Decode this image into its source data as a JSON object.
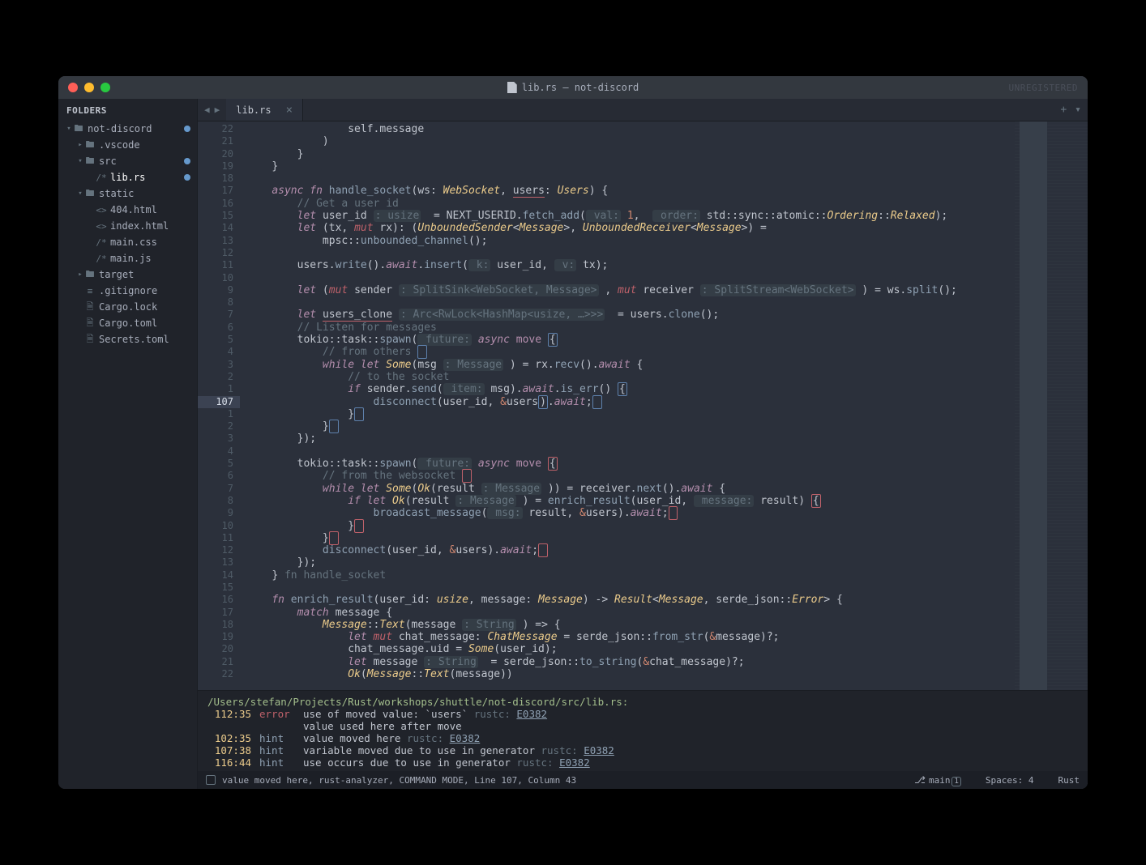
{
  "window": {
    "title": "lib.rs — not-discord",
    "unregistered": "UNREGISTERED"
  },
  "sidebar": {
    "header": "FOLDERS",
    "tree": [
      {
        "depth": 0,
        "arrow": "▾",
        "icon": "📁",
        "label": "not-discord",
        "dot": true
      },
      {
        "depth": 1,
        "arrow": "▸",
        "icon": "📁",
        "label": ".vscode"
      },
      {
        "depth": 1,
        "arrow": "▾",
        "icon": "📁",
        "label": "src",
        "dot": true
      },
      {
        "depth": 2,
        "arrow": "",
        "icon": "/*",
        "label": "lib.rs",
        "dot": true,
        "active": true
      },
      {
        "depth": 1,
        "arrow": "▾",
        "icon": "📁",
        "label": "static"
      },
      {
        "depth": 2,
        "arrow": "",
        "icon": "<>",
        "label": "404.html"
      },
      {
        "depth": 2,
        "arrow": "",
        "icon": "<>",
        "label": "index.html"
      },
      {
        "depth": 2,
        "arrow": "",
        "icon": "/*",
        "label": "main.css"
      },
      {
        "depth": 2,
        "arrow": "",
        "icon": "/*",
        "label": "main.js"
      },
      {
        "depth": 1,
        "arrow": "▸",
        "icon": "📁",
        "label": "target"
      },
      {
        "depth": 1,
        "arrow": "",
        "icon": "≡",
        "label": ".gitignore"
      },
      {
        "depth": 1,
        "arrow": "",
        "icon": "🗎",
        "label": "Cargo.lock"
      },
      {
        "depth": 1,
        "arrow": "",
        "icon": "🗎",
        "label": "Cargo.toml"
      },
      {
        "depth": 1,
        "arrow": "",
        "icon": "🗎",
        "label": "Secrets.toml"
      }
    ]
  },
  "tabs": {
    "open": [
      {
        "name": "lib.rs"
      }
    ]
  },
  "gutter": {
    "lines": [
      "22",
      "21",
      "20",
      "19",
      "18",
      "17",
      "16",
      "15",
      "14",
      "13",
      "12",
      "11",
      "10",
      "9",
      "8",
      "7",
      "6",
      "5",
      "4",
      "3",
      "2",
      "1",
      "107",
      "1",
      "2",
      "3",
      "4",
      "5",
      "6",
      "7",
      "8",
      "9",
      "10",
      "11",
      "12",
      "13",
      "14",
      "15",
      "16",
      "17",
      "18",
      "19",
      "20",
      "21",
      "22"
    ],
    "currentIndex": 22,
    "errorIndex": 27
  },
  "code_lines": [
    "                <span class='id'>self</span>.<span class='id'>message</span>",
    "            <span class='pn'>)</span>",
    "        <span class='pn'>}</span>",
    "    <span class='pn'>}</span>",
    "",
    "    <span class='kw'>async</span> <span class='kw'>fn</span> <span class='fn'>handle_socket</span>(<span class='id'>ws</span>: <span class='ty'>WebSocket</span>, <span class='red-u id'>users</span>: <span class='ty'>Users</span>) <span class='pn'>{</span>",
    "        <span class='com'>// Get a user id</span>",
    "        <span class='kw'>let</span> <span class='id'>user_id</span> <span class='param'>: usize</span>  = <span class='id'>NEXT_USERID</span>.<span class='meth'>fetch_add</span>(<span class='param'> val:</span> <span class='num'>1</span>,  <span class='param'> order:</span> <span class='id'>std</span>::<span class='id'>sync</span>::<span class='id'>atomic</span>::<span class='ty'>Ordering</span>::<span class='ty'>Relaxed</span>);",
    "        <span class='kw'>let</span> (<span class='id'>tx</span>, <span class='mut'>mut</span> <span class='id'>rx</span>): (<span class='ty'>UnboundedSender</span>&lt;<span class='ty'>Message</span>&gt;, <span class='ty'>UnboundedReceiver</span>&lt;<span class='ty'>Message</span>&gt;) =",
    "            <span class='id'>mpsc</span>::<span class='fn'>unbounded_channel</span>();",
    "",
    "        <span class='id'>users</span>.<span class='meth'>write</span>().<span class='kw'>await</span>.<span class='meth'>insert</span>(<span class='param'> k:</span> <span class='id'>user_id</span>, <span class='param'> v:</span> <span class='id'>tx</span>);",
    "",
    "        <span class='kw'>let</span> (<span class='mut'>mut</span> <span class='id'>sender</span> <span class='param'>: SplitSink&lt;WebSocket, Message&gt;</span> , <span class='mut'>mut</span> <span class='id'>receiver</span> <span class='param'>: SplitStream&lt;WebSocket&gt;</span> ) = <span class='id'>ws</span>.<span class='meth'>split</span>();",
    "",
    "        <span class='kw'>let</span> <span class='red-u id'>users_clone</span> <span class='param'>: Arc&lt;RwLock&lt;HashMap&lt;usize, …&gt;&gt;&gt;</span>  = <span class='id'>users</span>.<span class='meth'>clone</span>();",
    "        <span class='com'>// Listen for messages</span>",
    "        <span class='id'>tokio</span>::<span class='id'>task</span>::<span class='fn'>spawn</span>(<span class='param'> future:</span> <span class='kw'>async</span> <span class='kw2'>move</span> <span class='blue-box'>{</span>",
    "            <span class='com'>// from others</span> <span class='blue-box'> </span>",
    "            <span class='kw'>while</span> <span class='kw'>let</span> <span class='ty'>Some</span>(<span class='id'>msg</span> <span class='param'>: Message</span> ) = <span class='id'>rx</span>.<span class='meth'>recv</span>().<span class='kw'>await</span> <span class='pn'>{</span>",
    "                <span class='com'>// to the socket</span>",
    "                <span class='kw'>if</span> <span class='id'>sender</span>.<span class='meth'>send</span>(<span class='param'> item:</span> <span class='id'>msg</span>).<span class='kw'>await</span>.<span class='meth'>is_err</span>() <span class='blue-box'>{</span>",
    "                    <span class='fn'>disconnect</span>(<span class='id'>user_id</span>, <span class='hl'>&amp;</span><span class='id'>users</span><span class='blue-box'>)</span>.<span class='kw'>await</span>;<span class='blue-box'> </span>",
    "                <span class='pn'>}</span><span class='blue-box'> </span>",
    "            <span class='pn'>}</span><span class='blue-box'> </span>",
    "        <span class='pn'>}</span>);",
    "",
    "        <span class='id'>tokio</span>::<span class='id'>task</span>::<span class='fn'>spawn</span>(<span class='param'> future:</span> <span class='kw'>async</span> <span class='kw2'>move</span> <span class='red-box'>{</span>",
    "            <span class='com'>// from the websocket</span> <span class='red-box'> </span>",
    "            <span class='kw'>while</span> <span class='kw'>let</span> <span class='ty'>Some</span>(<span class='ty'>Ok</span>(<span class='id'>result</span> <span class='param'>: Message</span> )) = <span class='id'>receiver</span>.<span class='meth'>next</span>().<span class='kw'>await</span> <span class='pn'>{</span>",
    "                <span class='kw'>if</span> <span class='kw'>let</span> <span class='ty'>Ok</span>(<span class='id'>result</span> <span class='param'>: Message</span> ) = <span class='fn'>enrich_result</span>(<span class='id'>user_id</span>, <span class='param'> message:</span> <span class='id'>result</span>) <span class='red-box'>{</span>",
    "                    <span class='fn'>broadcast_message</span>(<span class='param'> msg:</span> <span class='id'>result</span>, <span class='hl'>&amp;</span><span class='id'>users</span>).<span class='kw'>await</span>;<span class='red-box'> </span>",
    "                <span class='pn'>}</span><span class='red-box'> </span>",
    "            <span class='pn'>}</span><span class='red-box'> </span>",
    "            <span class='fn'>disconnect</span>(<span class='id'>user_id</span>, <span class='hl'>&amp;</span><span class='id'>users</span>).<span class='kw'>await</span>;<span class='red-box'> </span>",
    "        <span class='pn'>}</span>);",
    "    <span class='pn'>}</span> <span class='com'>fn handle_socket</span>",
    "",
    "    <span class='kw'>fn</span> <span class='fn'>enrich_result</span>(<span class='id'>user_id</span>: <span class='ty'>usize</span>, <span class='id'>message</span>: <span class='ty'>Message</span>) -&gt; <span class='ty'>Result</span>&lt;<span class='ty'>Message</span>, <span class='id'>serde_json</span>::<span class='ty'>Error</span>&gt; <span class='pn'>{</span>",
    "        <span class='kw'>match</span> <span class='id'>message</span> <span class='pn'>{</span>",
    "            <span class='ty'>Message</span>::<span class='ty'>Text</span>(<span class='id'>message</span> <span class='param'>: String</span> ) =&gt; <span class='pn'>{</span>",
    "                <span class='kw'>let</span> <span class='mut'>mut</span> <span class='id'>chat_message</span>: <span class='ty'>ChatMessage</span> = <span class='id'>serde_json</span>::<span class='fn'>from_str</span>(<span class='hl'>&amp;</span><span class='id'>message</span>)?;",
    "                <span class='id'>chat_message</span>.<span class='id'>uid</span> = <span class='ty'>Some</span>(<span class='id'>user_id</span>);",
    "                <span class='kw'>let</span> <span class='id'>message</span> <span class='param'>: String</span>  = <span class='id'>serde_json</span>::<span class='fn'>to_string</span>(<span class='hl'>&amp;</span><span class='id'>chat_message</span>)?;",
    "                <span class='ty'>Ok</span>(<span class='ty'>Message</span>::<span class='ty'>Text</span>(<span class='id'>message</span>))"
  ],
  "diagnostics": {
    "path": "/Users/stefan/Projects/Rust/workshops/shuttle/not-discord/src/lib.rs:",
    "rows": [
      {
        "loc": "112:35",
        "level": "error",
        "msg": "use of moved value: `users`",
        "src": "rustc:",
        "code": "E0382"
      },
      {
        "loc": "",
        "level": "",
        "msg": "value used here after move",
        "src": "",
        "code": ""
      },
      {
        "loc": "102:35",
        "level": "hint",
        "msg": "value moved here",
        "src": "rustc:",
        "code": "E0382"
      },
      {
        "loc": "107:38",
        "level": "hint",
        "msg": "variable moved due to use in generator",
        "src": "rustc:",
        "code": "E0382"
      },
      {
        "loc": "116:44",
        "level": "hint",
        "msg": "use occurs due to use in generator",
        "src": "rustc:",
        "code": "E0382"
      }
    ]
  },
  "statusbar": {
    "left": "value moved here, rust-analyzer, COMMAND MODE, Line 107, Column 43",
    "branch": "main",
    "branch_count": "1",
    "spaces": "Spaces: 4",
    "lang": "Rust"
  }
}
